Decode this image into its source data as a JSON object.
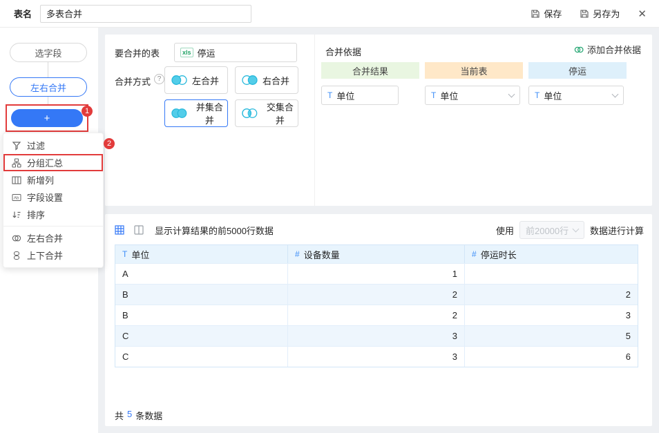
{
  "topbar": {
    "name_label": "表名",
    "name_value": "多表合并",
    "save": "保存",
    "save_as": "另存为",
    "close": "✕"
  },
  "icons": {
    "help": "?",
    "field_settings_glyph": "Ab"
  },
  "sidebar": {
    "select_field": "选字段",
    "lr_merge": "左右合并",
    "add_button": "+",
    "badge_1": "1",
    "badge_2": "2",
    "menu": [
      {
        "icon": "filter-icon",
        "label": "过滤"
      },
      {
        "icon": "group-summary-icon",
        "label": "分组汇总"
      },
      {
        "icon": "add-column-icon",
        "label": "新增列"
      },
      {
        "icon": "field-settings-icon",
        "label": "字段设置"
      },
      {
        "icon": "sort-icon",
        "label": "排序"
      },
      {
        "icon": "lr-merge-icon",
        "label": "左右合并"
      },
      {
        "icon": "tb-merge-icon",
        "label": "上下合并"
      }
    ]
  },
  "merge": {
    "table_label": "要合并的表",
    "file_badge": "xls",
    "file_name": "停运",
    "method_label": "合并方式",
    "methods": [
      {
        "label": "左合并",
        "selected": false
      },
      {
        "label": "右合并",
        "selected": false
      },
      {
        "label": "并集合并",
        "selected": true
      },
      {
        "label": "交集合并",
        "selected": false
      }
    ],
    "basis_title": "合并依据",
    "add_basis": "添加合并依据",
    "field_type": "T",
    "columns": [
      {
        "title": "合并结果",
        "field": "单位",
        "color": "#e9f6e1",
        "has_chevron": false
      },
      {
        "title": "当前表",
        "field": "单位",
        "color": "#ffe8c8",
        "has_chevron": true
      },
      {
        "title": "停运",
        "field": "单位",
        "color": "#def0fb",
        "has_chevron": true
      }
    ]
  },
  "result": {
    "toolbar_text": "显示计算结果的前5000行数据",
    "use_prefix": "使用",
    "use_value": "前20000行",
    "use_suffix": "数据进行计算",
    "headers": [
      {
        "type": "T",
        "label": "单位"
      },
      {
        "type": "#",
        "label": "设备数量"
      },
      {
        "type": "#",
        "label": "停运时长"
      }
    ],
    "rows": [
      [
        "A",
        "1",
        ""
      ],
      [
        "B",
        "2",
        "2"
      ],
      [
        "B",
        "2",
        "3"
      ],
      [
        "C",
        "3",
        "5"
      ],
      [
        "C",
        "3",
        "6"
      ]
    ],
    "total_prefix": "共",
    "total_count": "5",
    "total_suffix": "条数据"
  },
  "colors": {
    "primary": "#3478f6",
    "annotation": "#e23b3b",
    "venn_fill": "#53cde9",
    "venn_stroke": "#28b9dc",
    "table_header_bg": "#e8f4fd",
    "row_alt_bg": "#eef6fd",
    "result_green": "#e9f6e1",
    "current_orange": "#ffe8c8",
    "source_blue": "#def0fb"
  }
}
